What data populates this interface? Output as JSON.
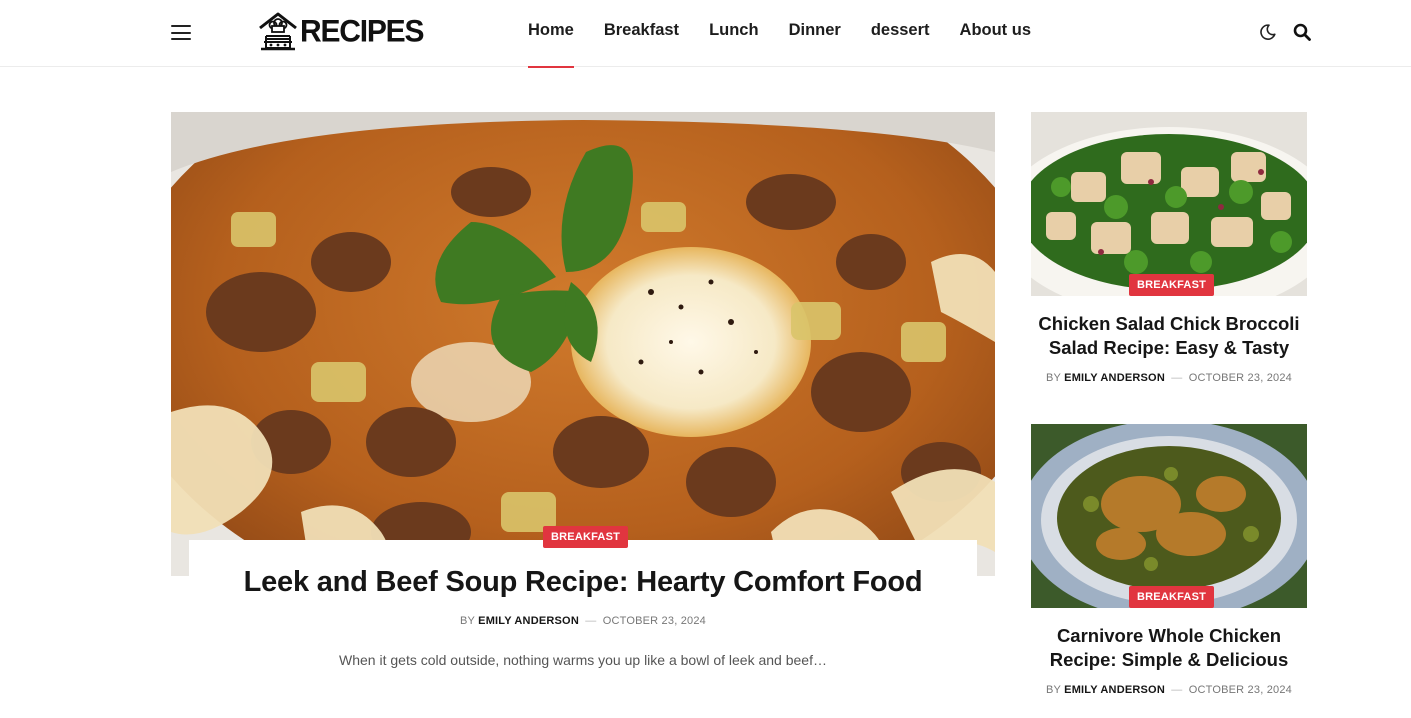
{
  "header": {
    "logo_text": "RECIPES",
    "nav": [
      {
        "label": "Home",
        "active": true
      },
      {
        "label": "Breakfast"
      },
      {
        "label": "Lunch"
      },
      {
        "label": "Dinner"
      },
      {
        "label": "dessert"
      },
      {
        "label": "About us"
      }
    ],
    "icons": [
      "menu-icon",
      "moon-icon",
      "search-icon"
    ]
  },
  "featured": {
    "category": "BREAKFAST",
    "title": "Leek and Beef Soup Recipe: Hearty Comfort Food",
    "by": "BY",
    "author": "EMILY ANDERSON",
    "date": "OCTOBER 23, 2024",
    "excerpt": "When it gets cold outside, nothing warms you up like a bowl of leek and beef…"
  },
  "sidebar": [
    {
      "category": "BREAKFAST",
      "title": "Chicken Salad Chick Broccoli Salad Recipe: Easy & Tasty",
      "by": "BY",
      "author": "EMILY ANDERSON",
      "date": "OCTOBER 23, 2024"
    },
    {
      "category": "BREAKFAST",
      "title": "Carnivore Whole Chicken Recipe: Simple & Delicious",
      "by": "BY",
      "author": "EMILY ANDERSON",
      "date": "OCTOBER 23, 2024"
    }
  ],
  "colors": {
    "accent": "#e1353f",
    "text": "#161616",
    "meta": "#777777"
  }
}
